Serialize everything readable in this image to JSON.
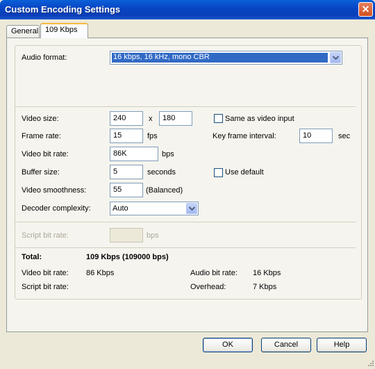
{
  "window": {
    "title": "Custom Encoding Settings",
    "close_glyph": "✕"
  },
  "tabs": [
    {
      "label": "General",
      "active": false
    },
    {
      "label": "109 Kbps",
      "active": true
    }
  ],
  "audio": {
    "label": "Audio format:",
    "value": "16 kbps, 16 kHz, mono CBR"
  },
  "video": {
    "size_label": "Video size:",
    "width": "240",
    "x_sep": "x",
    "height": "180",
    "same_as_input_label": "Same as video input",
    "frame_rate_label": "Frame rate:",
    "frame_rate": "15",
    "fps_unit": "fps",
    "key_frame_label": "Key frame interval:",
    "key_frame": "10",
    "key_frame_unit": "sec",
    "bit_rate_label": "Video bit rate:",
    "bit_rate": "86K",
    "bit_rate_unit": "bps",
    "buffer_label": "Buffer size:",
    "buffer": "5",
    "buffer_unit": "seconds",
    "use_default_label": "Use default",
    "smoothness_label": "Video smoothness:",
    "smoothness": "55",
    "smoothness_note": "(Balanced)",
    "decoder_label": "Decoder complexity:",
    "decoder": "Auto"
  },
  "script": {
    "label": "Script bit rate:",
    "value": "",
    "unit": "bps"
  },
  "summary": {
    "total_label": "Total:",
    "total_value": "109 Kbps (109000 bps)",
    "video_label": "Video bit rate:",
    "video_value": "86 Kbps",
    "audio_label": "Audio bit rate:",
    "audio_value": "16 Kbps",
    "script_label": "Script bit rate:",
    "overhead_label": "Overhead:",
    "overhead_value": "7 Kbps"
  },
  "buttons": {
    "ok": "OK",
    "cancel": "Cancel",
    "help": "Help"
  },
  "colors": {
    "titlebar": "#0846c4",
    "selection": "#316ac5",
    "dialog_bg": "#ece9d8"
  }
}
